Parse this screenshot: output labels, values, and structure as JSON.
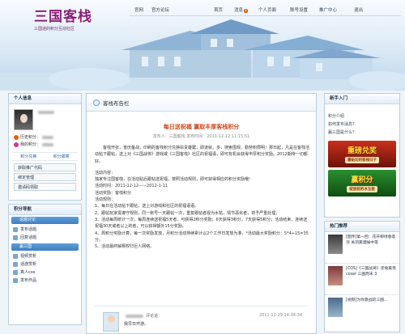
{
  "header": {
    "logo_text": "三国客栈",
    "logo_subtitle": "三国迷的积分互动社区",
    "nav_left": [
      "官网",
      "官方论坛"
    ],
    "nav_right": [
      {
        "label": "首页"
      },
      {
        "label": "消息",
        "badge": "1"
      },
      {
        "label": "个人页面"
      },
      {
        "label": "账号设置"
      },
      {
        "label": "推广中心"
      },
      {
        "label": "退出"
      }
    ]
  },
  "left": {
    "profile_title": "个人信息",
    "history_label": "历史积分：",
    "current_label": "我的积分：",
    "tab_points": "积分兑换",
    "tab_mail": "积分邮寄",
    "buttons": [
      "获取推广代码",
      "绑定管理",
      "邀请码领取"
    ],
    "nav_title": "积分导航",
    "groups": [
      {
        "label": "话题讨论",
        "items": [
          "发布话题",
          "回复话题"
        ]
      },
      {
        "label": "赢三国",
        "items": [
          "视频赏析",
          "话游赏析",
          "真人cos",
          "发布作品"
        ]
      }
    ]
  },
  "main": {
    "tab_title": "客栈布告栏",
    "article_title": "每日送祝福 赢取丰厚客栈积分",
    "meta": "发布人：三国客栈 发布时间：2011-12-12 11:15:51",
    "paragraphs": [
      "客栈开张，普庆备战，印刷的客栈积分兑换昂贵雄踞，即道就。多，搜索围观，勤劳积攒明！那日起，凡是在客栈活动帖下跟帖，送上对《三国战将》游戏或《三国客栈》社区的祝福语，即可有机会获得丰厚积分奖励。2012期待一切都好。",
      "活动内容：",
      "独家专注国客栈，在活动贴后跟帖送祝福，按照活动规则，即可获得相应的积分奖励哦!",
      "活动时间：2011-12-12——2012-1-11",
      "活动奖励：客栈积分",
      "活动规则：",
      "1、每日在活动帖下跟帖，送上对游戏和社区的祝福语语。",
      "2、跟帖玩家需遵守规则，同一账号一天跟帖一次，重复跟帖者视为水帖，情节恶劣者，将予严重处理；",
      "3、活动每周统计一次，每周连续送祝福5天者，可获得2积分奖励；6天获得3积分，7天获得5积分；活动结束，连续送祝福30天或者以上的者，可以获得额外15分奖励。",
      "4、周积分奖励计算，每一次奖励发放，月积分活动持续累计以2个工作日发放为准，*活动最大奖励积分：5*4+15=35分。",
      "5、活动最终解释权归巨人网络。"
    ],
    "comment": {
      "label": "评论道：",
      "text": "我早日开游。",
      "time": "2011-12-29 14:04:34"
    }
  },
  "right": {
    "guide_title": "新手入门",
    "guide_items": [
      "积分介绍",
      "如何发布消息?",
      "赢三国是什么？"
    ],
    "promo1_big": "重磅兑奖",
    "promo1_small": "最贴切的客栈日子",
    "promo2_big": "赢积分",
    "promo2_small": "绽放前的冰玉姿",
    "hot_title": "热门推荐",
    "hot_items": [
      "[图传]第一回：花开柳绿春意浓 关羽美酒候中等",
      "[COS]《三国战将》赤兔美羡coser 三国周末 3",
      "[视频]为你激战的三国..."
    ]
  },
  "colors": {
    "accent_red": "#d2471c",
    "link_blue": "#3f7fc0",
    "border": "#b8cfe1",
    "logo_purple": "#8a1f7a"
  }
}
